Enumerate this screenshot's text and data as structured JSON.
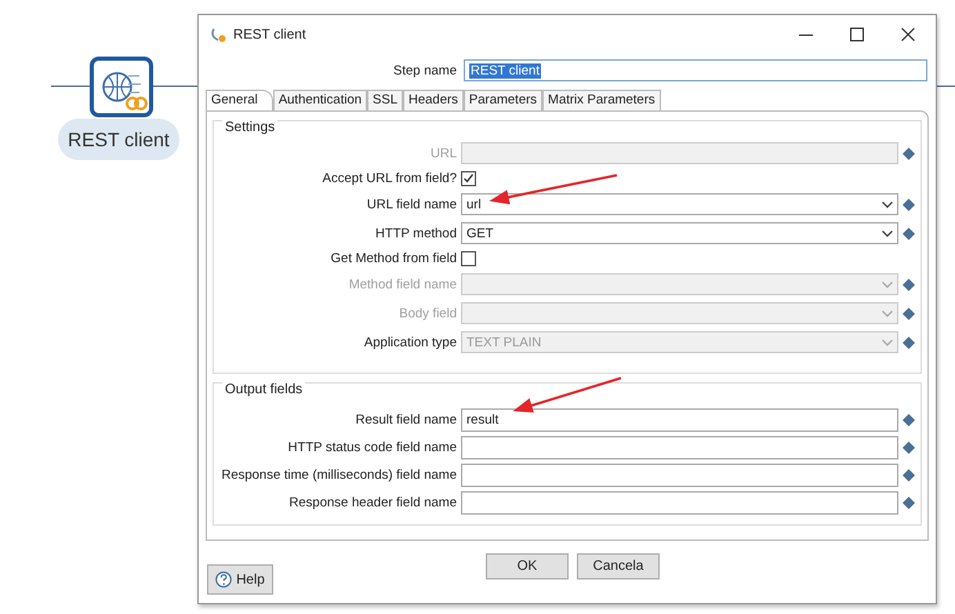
{
  "canvas": {
    "step": {
      "label": "REST client"
    }
  },
  "dialog": {
    "title": "REST client",
    "step_name": {
      "label": "Step name",
      "value": "REST client",
      "text_selected": true
    },
    "tabs": [
      {
        "label": "General",
        "selected": true
      },
      {
        "label": "Authentication",
        "selected": false
      },
      {
        "label": "SSL",
        "selected": false
      },
      {
        "label": "Headers",
        "selected": false
      },
      {
        "label": "Parameters",
        "selected": false
      },
      {
        "label": "Matrix Parameters",
        "selected": false
      }
    ],
    "settings": {
      "title": "Settings",
      "rows": [
        {
          "kind": "text",
          "label": "URL",
          "disabled": true,
          "label_disabled": true
        },
        {
          "kind": "checkbox",
          "label": "Accept URL from field?",
          "checked": true
        },
        {
          "kind": "dropdown",
          "label": "URL field name",
          "value": "url",
          "disabled": false,
          "label_disabled": false
        },
        {
          "kind": "dropdown",
          "label": "HTTP method",
          "value": "GET",
          "disabled": false,
          "label_disabled": false
        },
        {
          "kind": "checkbox",
          "label": "Get Method from field",
          "checked": false
        },
        {
          "kind": "dropdown",
          "label": "Method field name",
          "disabled": true,
          "label_disabled": true
        },
        {
          "kind": "dropdown",
          "label": "Body field",
          "disabled": true,
          "label_disabled": true
        },
        {
          "kind": "dropdown",
          "label": "Application type",
          "value": "TEXT PLAIN",
          "disabled": true,
          "label_disabled": false
        }
      ]
    },
    "output": {
      "title": "Output fields",
      "rows": [
        {
          "kind": "text",
          "label": "Result field name",
          "value": "result",
          "disabled": false,
          "label_disabled": false
        },
        {
          "kind": "text",
          "label": "HTTP status code field name",
          "disabled": false,
          "label_disabled": false
        },
        {
          "kind": "text",
          "label": "Response time (milliseconds) field name",
          "disabled": false,
          "label_disabled": false
        },
        {
          "kind": "text",
          "label": "Response header field name",
          "disabled": false,
          "label_disabled": false
        }
      ]
    },
    "buttons": [
      "OK",
      "Cancela"
    ],
    "help": "Help"
  }
}
